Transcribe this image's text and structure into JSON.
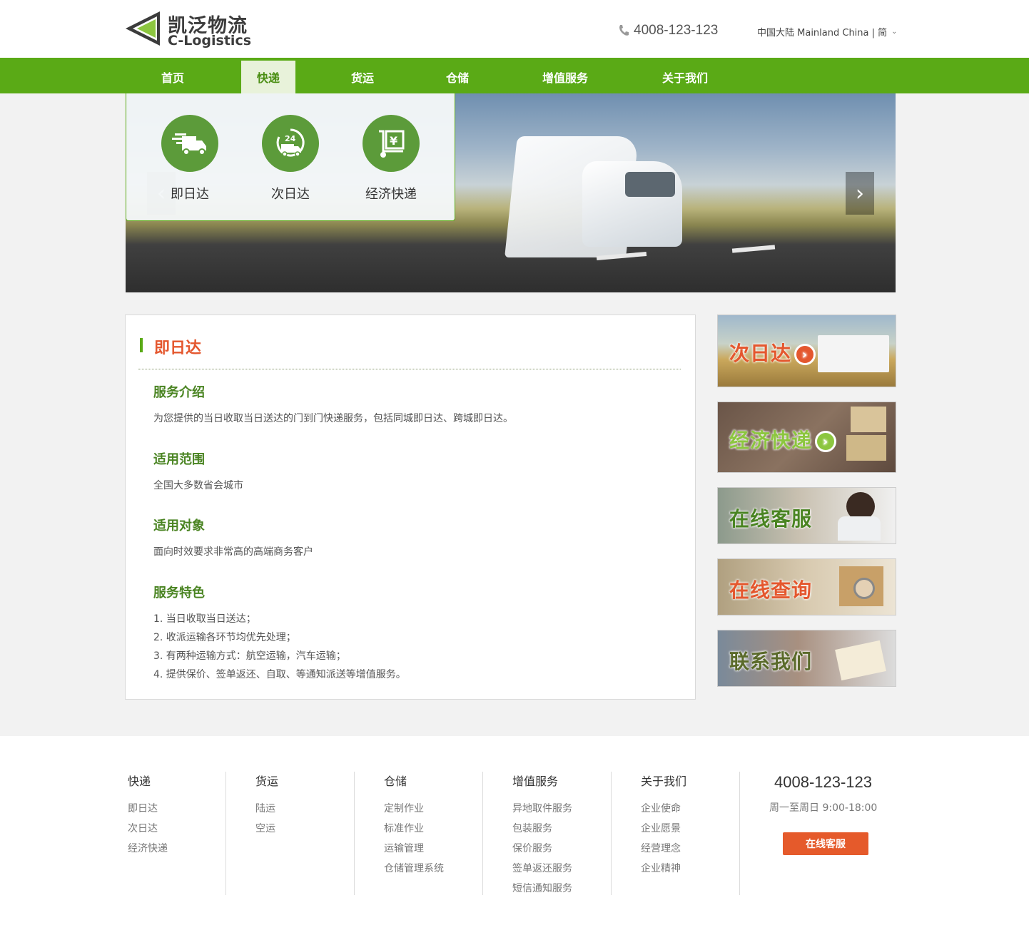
{
  "header": {
    "logo_cn": "凯泛物流",
    "logo_en": "C-Logistics",
    "phone": "4008-123-123",
    "region": "中国大陆 Mainland China | 简"
  },
  "nav": {
    "items": [
      {
        "label": "首页"
      },
      {
        "label": "快递"
      },
      {
        "label": "货运"
      },
      {
        "label": "仓储"
      },
      {
        "label": "增值服务"
      },
      {
        "label": "关于我们"
      }
    ],
    "active": "快递"
  },
  "dropdown": {
    "services": [
      {
        "label": "即日达",
        "icon": "fast-truck-icon"
      },
      {
        "label": "次日达",
        "icon": "24h-delivery-icon"
      },
      {
        "label": "经济快递",
        "icon": "yen-cart-icon"
      }
    ]
  },
  "content": {
    "title": "即日达",
    "sections": [
      {
        "heading": "服务介绍",
        "lines": [
          "为您提供的当日收取当日送达的门到门快递服务，包括同城即日达、跨城即日达。"
        ]
      },
      {
        "heading": "适用范围",
        "lines": [
          "全国大多数省会城市"
        ]
      },
      {
        "heading": "适用对象",
        "lines": [
          "面向时效要求非常高的高端商务客户"
        ]
      },
      {
        "heading": "服务特色",
        "lines": [
          "1. 当日收取当日送达；",
          "2. 收派运输各环节均优先处理；",
          "3. 有两种运输方式：航空运输，汽车运输；",
          "4. 提供保价、签单返还、自取、等通知派送等增值服务。"
        ]
      }
    ]
  },
  "sidebar": {
    "banners": [
      {
        "label": "次日达"
      },
      {
        "label": "经济快递"
      },
      {
        "label": "在线客服"
      },
      {
        "label": "在线查询"
      },
      {
        "label": "联系我们"
      }
    ]
  },
  "footer": {
    "columns": [
      {
        "heading": "快递",
        "links": [
          "即日达",
          "次日达",
          "经济快递"
        ]
      },
      {
        "heading": "货运",
        "links": [
          "陆运",
          "空运"
        ]
      },
      {
        "heading": "仓储",
        "links": [
          "定制作业",
          "标准作业",
          "运输管理",
          "仓储管理系统"
        ]
      },
      {
        "heading": "增值服务",
        "links": [
          "异地取件服务",
          "包装服务",
          "保价服务",
          "签单返还服务",
          "短信通知服务"
        ]
      },
      {
        "heading": "关于我们",
        "links": [
          "企业使命",
          "企业愿景",
          "经营理念",
          "企业精神"
        ]
      }
    ],
    "phone": "4008-123-123",
    "hours": "周一至周日  9:00-18:00",
    "service_button": "在线客服"
  },
  "colors": {
    "brand_green": "#5aaa16",
    "accent_orange": "#e4572e",
    "heading_green": "#4a8422"
  }
}
